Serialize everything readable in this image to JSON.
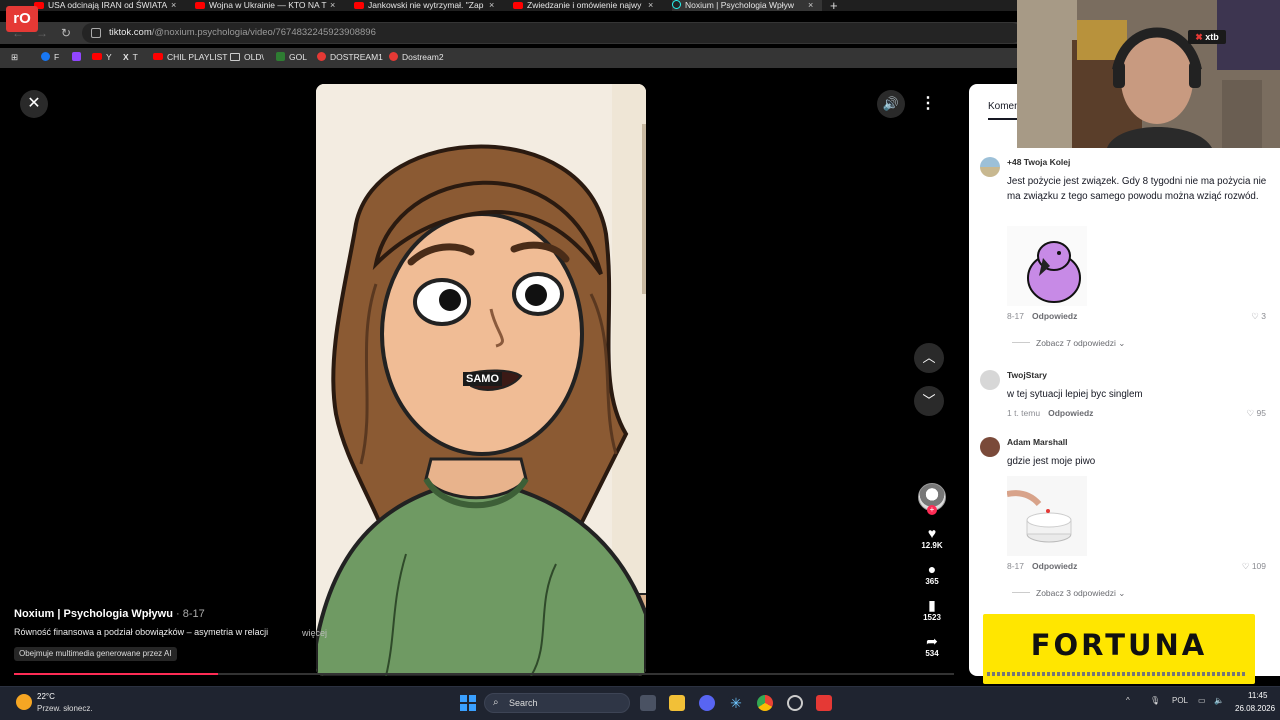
{
  "browser": {
    "tabs": [
      {
        "title": "USA odcinają IRAN od ŚWIATA"
      },
      {
        "title": "Wojna w Ukrainie — KTO NA T"
      },
      {
        "title": "Jankowski nie wytrzymał. \"Zap"
      },
      {
        "title": "Zwiedzanie i omówienie najwy"
      },
      {
        "title": "Noxium | Psychologia Wpływ"
      }
    ],
    "close_glyph": "×",
    "new_tab_glyph": "+",
    "url_domain": "tiktok.com",
    "url_path": "/@noxium.psychologia/video/7674832245923908896",
    "bookmarks": [
      {
        "label": "F"
      },
      {
        "label": ""
      },
      {
        "label": "Y"
      },
      {
        "label": "T"
      },
      {
        "label": "CHIL PLAYLIST"
      },
      {
        "label": "OLD\\"
      },
      {
        "label": "GOL"
      },
      {
        "label": "DOSTREAM1"
      },
      {
        "label": "Dostream2"
      }
    ]
  },
  "logo_text": "rO",
  "video": {
    "caption_word": "SAMO",
    "author": "Noxium | Psychologia Wpływu",
    "date": " · 8-17",
    "description": "Równość finansowa a podział obowiązków – asymetria w relacji",
    "more_label": "więcej",
    "ai_label": "Obejmuje multimedia generowane przez AI",
    "progress": 0.217,
    "likes": "12.9K",
    "comments": "365",
    "saves": "1523",
    "shares": "534",
    "accent": "#fe2c55"
  },
  "comments_panel": {
    "tab_label": "Komen",
    "comments": [
      {
        "name": "+48 Twoja Kolej",
        "text": "Jest pożycie jest związek. Gdy 8 tygodni nie ma pożycia nie ma związku z tego samego powodu można wziąć rozwód.",
        "date": "8-17",
        "reply": "Odpowiedz",
        "likes": "3",
        "replies": "Zobacz 7 odpowiedzi"
      },
      {
        "name": "TwojStary",
        "text": "w tej sytuacji lepiej byc singlem",
        "date": "1 t. temu",
        "reply": "Odpowiedz",
        "likes": "95",
        "replies": ""
      },
      {
        "name": "Adam Marshall",
        "text": "gdzie jest moje piwo",
        "date": "8-17",
        "reply": "Odpowiedz",
        "likes": "109",
        "replies": "Zobacz 3 odpowiedzi"
      }
    ]
  },
  "ad": {
    "brand": "FORTUNA",
    "color": "#ffe600"
  },
  "webcam_badge": "xtb",
  "taskbar": {
    "temperature": "22°C",
    "weather": "Przew. słonecz.",
    "search_placeholder": "Search",
    "language": "POL",
    "time": "11:45",
    "date": "26.08.2026"
  }
}
